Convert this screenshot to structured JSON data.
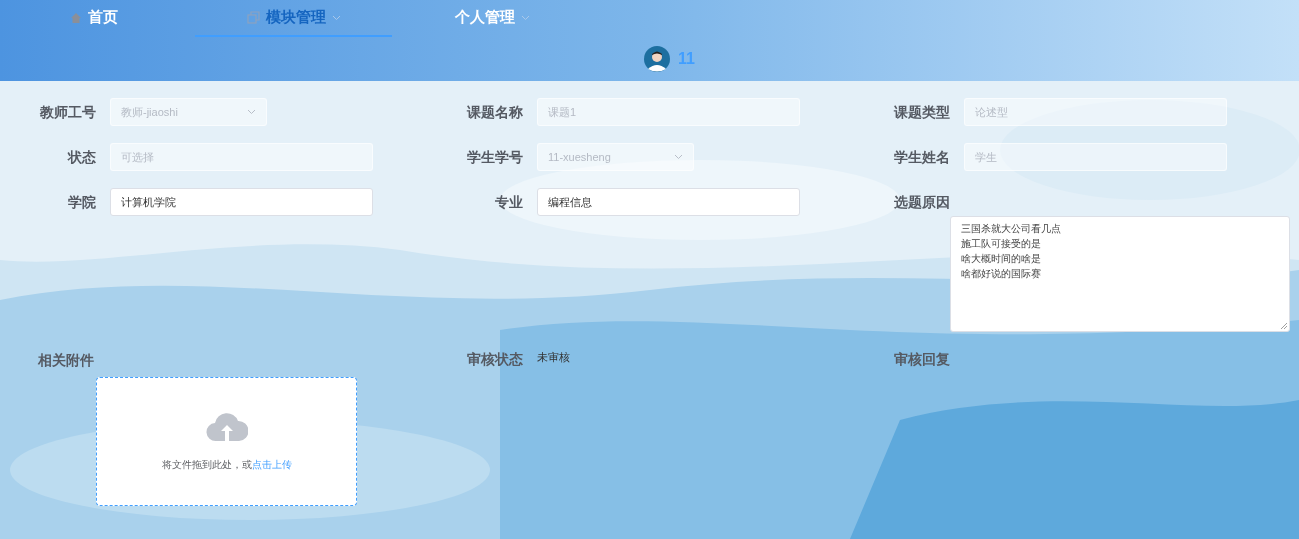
{
  "nav": [
    {
      "label": "首页",
      "selected": false,
      "dropdown": false
    },
    {
      "label": "模块管理",
      "selected": true,
      "dropdown": true
    },
    {
      "label": "个人管理",
      "selected": false,
      "dropdown": true
    }
  ],
  "user": {
    "name": "11"
  },
  "rows": [
    [
      {
        "label": "教师工号",
        "kind": "select",
        "placeholder": "教师-jiaoshi",
        "disabled": true
      },
      {
        "label": "课题名称",
        "kind": "input",
        "placeholder": "课题1",
        "disabled": true
      },
      {
        "label": "课题类型",
        "kind": "input",
        "placeholder": "论述型",
        "disabled": true
      }
    ],
    [
      {
        "label": "状态",
        "kind": "input",
        "placeholder": "可选择",
        "disabled": true
      },
      {
        "label": "学生学号",
        "kind": "select",
        "placeholder": "11-xuesheng",
        "disabled": true
      },
      {
        "label": "学生姓名",
        "kind": "input",
        "placeholder": "学生",
        "disabled": true
      }
    ],
    [
      {
        "label": "学院",
        "kind": "input",
        "value": "计算机学院",
        "disabled": false
      },
      {
        "label": "专业",
        "kind": "input",
        "value": "编程信息",
        "disabled": false
      },
      {
        "label": "选题原因",
        "kind": "textarea",
        "lines": [
          "三国杀就大公司看几点",
          "施工队可接受的是",
          "啥大概时间的啥是",
          "啥都好说的国际赛"
        ]
      }
    ],
    [
      {
        "label": "相关附件",
        "kind": "upload",
        "hint": "将文件拖到此处，或",
        "link": "点击上传"
      },
      {
        "label": "审核状态",
        "kind": "text",
        "value": "未审核"
      },
      {
        "label": "审核回复",
        "kind": "text"
      }
    ]
  ]
}
